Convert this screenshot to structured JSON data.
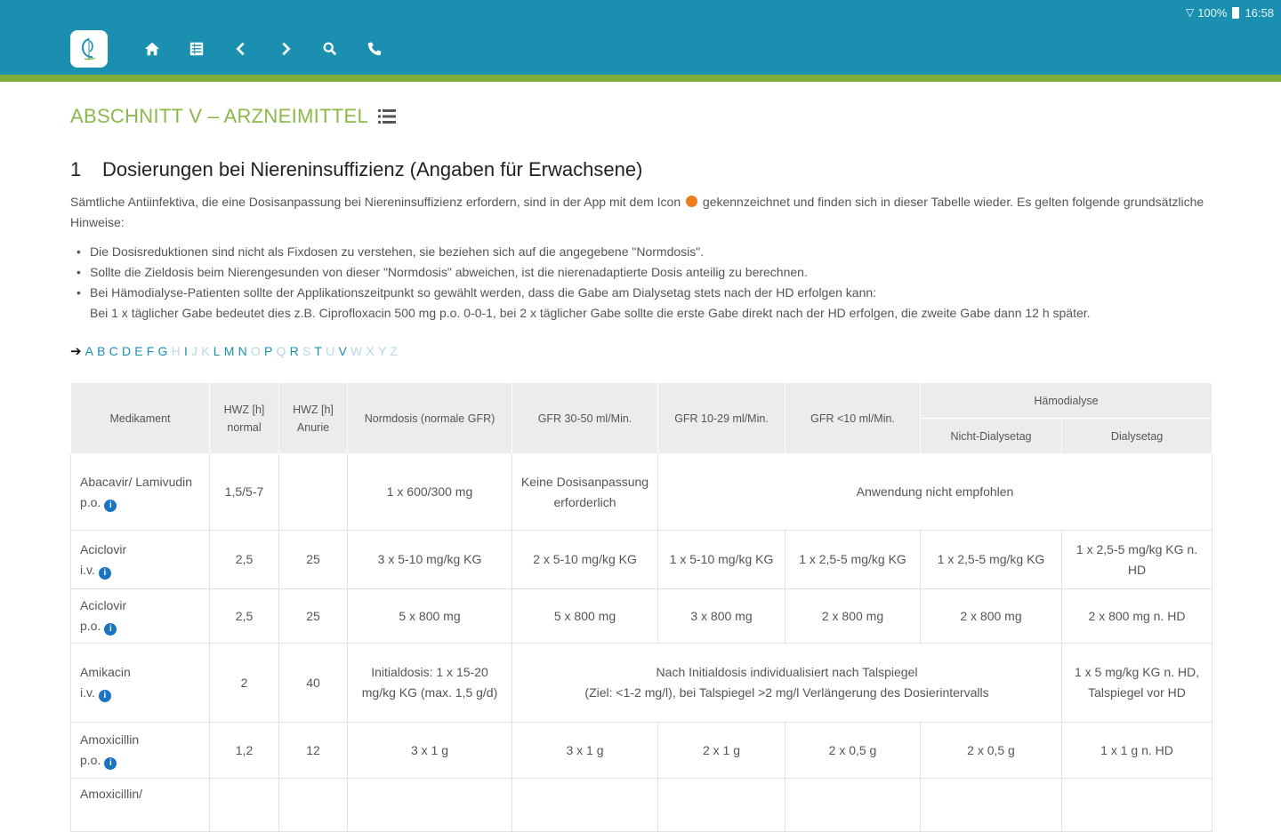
{
  "status": {
    "battery": "100%",
    "time": "16:58"
  },
  "toolbar": {
    "logo_alt": "app-logo",
    "icons": [
      "home-icon",
      "list-icon",
      "back-icon",
      "forward-icon",
      "search-icon",
      "phone-icon"
    ]
  },
  "section": {
    "title": "ABSCHNITT V – ARZNEIMITTEL"
  },
  "heading": {
    "number": "1",
    "text": "Dosierungen bei Niereninsuffizienz (Angaben für Erwachsene)"
  },
  "intro": {
    "before_icon": "Sämtliche Antiinfektiva, die eine Dosisanpassung bei Niereninsuffizienz erfordern, sind in der App mit dem Icon",
    "after_icon": "gekennzeichnet und finden sich in dieser Tabelle wieder. Es gelten folgende grundsätzliche Hinweise:"
  },
  "bullets": [
    "Die Dosisreduktionen sind nicht als Fixdosen zu verstehen, sie beziehen sich auf die angegebene \"Normdosis\".",
    "Sollte die Zieldosis beim Nierengesunden von dieser \"Normdosis\" abweichen, ist die nierenadaptierte Dosis anteilig zu berechnen.",
    "Bei Hämodialyse-Patienten sollte der Applikationszeitpunkt so gewählt werden, dass die Gabe am Dialysetag stets nach der HD erfolgen kann:"
  ],
  "bullet_continuation": "Bei 1 x täglicher Gabe bedeutet dies z.B. Ciprofloxacin 500 mg p.o. 0-0-1, bei 2 x täglicher Gabe sollte die erste Gabe direkt nach der HD erfolgen, die zweite Gabe dann 12 h später.",
  "alphabet": [
    {
      "l": "A",
      "on": true
    },
    {
      "l": "B",
      "on": true
    },
    {
      "l": "C",
      "on": true
    },
    {
      "l": "D",
      "on": true
    },
    {
      "l": "E",
      "on": true
    },
    {
      "l": "F",
      "on": true
    },
    {
      "l": "G",
      "on": true
    },
    {
      "l": "H",
      "on": false
    },
    {
      "l": "I",
      "on": true
    },
    {
      "l": "J",
      "on": false
    },
    {
      "l": "K",
      "on": false
    },
    {
      "l": "L",
      "on": true
    },
    {
      "l": "M",
      "on": true
    },
    {
      "l": "N",
      "on": true
    },
    {
      "l": "O",
      "on": false
    },
    {
      "l": "P",
      "on": true
    },
    {
      "l": "Q",
      "on": false
    },
    {
      "l": "R",
      "on": true
    },
    {
      "l": "S",
      "on": false
    },
    {
      "l": "T",
      "on": true
    },
    {
      "l": "U",
      "on": false
    },
    {
      "l": "V",
      "on": true
    },
    {
      "l": "W",
      "on": false
    },
    {
      "l": "X",
      "on": false
    },
    {
      "l": "Y",
      "on": false
    },
    {
      "l": "Z",
      "on": false
    }
  ],
  "table": {
    "headers": {
      "medikament": "Medikament",
      "hwz_normal": "HWZ [h] normal",
      "hwz_anurie": "HWZ [h] Anurie",
      "normdosis": "Normdosis (normale GFR)",
      "gfr_30_50": "GFR 30-50 ml/Min.",
      "gfr_10_29": "GFR 10-29 ml/Min.",
      "gfr_lt10": "GFR <10 ml/Min.",
      "haemodialyse": "Hämodialyse",
      "nicht_dialysetag": "Nicht-Dialysetag",
      "dialysetag": "Dialysetag"
    },
    "rows": [
      {
        "drug": "Abacavir/ Lamivudin",
        "route": "p.o.",
        "hwz_n": "1,5/5-7",
        "hwz_a": "",
        "norm": "1 x 600/300 mg",
        "gfr3050": "Keine Dosisanpassung erforderlich",
        "span": "Anwendung nicht empfohlen"
      },
      {
        "drug": "Aciclovir",
        "route": "i.v.",
        "hwz_n": "2,5",
        "hwz_a": "25",
        "norm": "3 x 5-10 mg/kg KG",
        "gfr3050": "2 x 5-10 mg/kg KG",
        "gfr1029": "1 x 5-10 mg/kg KG",
        "gfrlt10": "1 x 2,5-5 mg/kg KG",
        "nichtdt": "1 x 2,5-5 mg/kg KG",
        "dt": "1 x 2,5-5 mg/kg KG n. HD"
      },
      {
        "drug": "Aciclovir",
        "route": "p.o.",
        "hwz_n": "2,5",
        "hwz_a": "25",
        "norm": "5 x 800 mg",
        "gfr3050": "5 x 800 mg",
        "gfr1029": "3 x 800 mg",
        "gfrlt10": "2 x 800 mg",
        "nichtdt": "2 x 800 mg",
        "dt": "2 x 800 mg n. HD"
      },
      {
        "drug": "Amikacin",
        "route": "i.v.",
        "hwz_n": "2",
        "hwz_a": "40",
        "norm": "Initialdosis: 1 x 15-20 mg/kg KG (max. 1,5 g/d)",
        "span_line1": "Nach Initialdosis individualisiert nach Talspiegel",
        "span_line2": "(Ziel: <1-2 mg/l), bei Talspiegel >2 mg/l Verlängerung des Dosierintervalls",
        "dt": "1 x 5 mg/kg KG n. HD, Talspiegel vor HD"
      },
      {
        "drug": "Amoxicillin",
        "route": "p.o.",
        "hwz_n": "1,2",
        "hwz_a": "12",
        "norm": "3 x 1 g",
        "gfr3050": "3 x 1 g",
        "gfr1029": "2 x 1 g",
        "gfrlt10": "2 x 0,5 g",
        "nichtdt": "2 x 0,5 g",
        "dt": "1 x 1 g n. HD"
      },
      {
        "drug": "Amoxicillin/"
      }
    ]
  }
}
